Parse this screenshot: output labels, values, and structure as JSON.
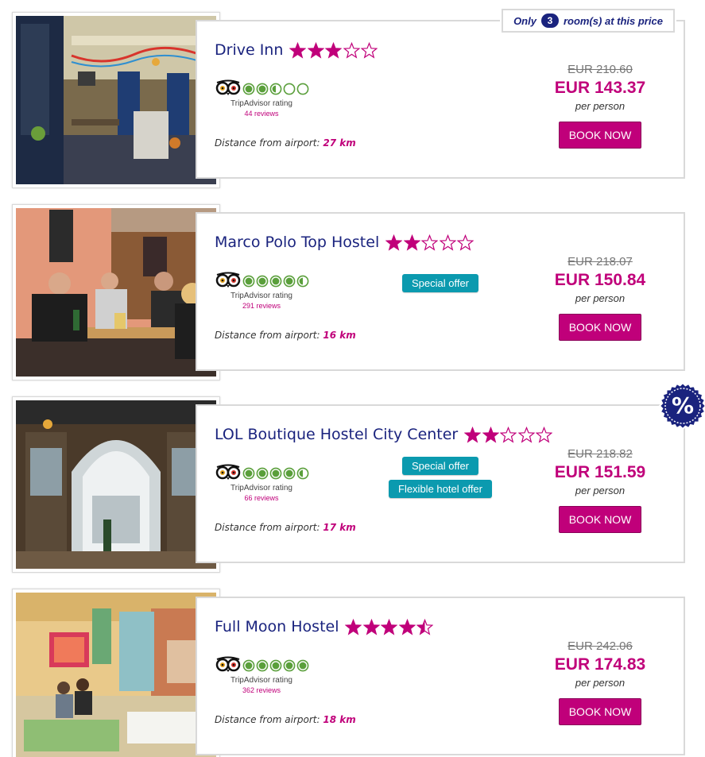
{
  "availability_tag": {
    "prefix": "Only",
    "count": "3",
    "suffix": "room(s) at this price"
  },
  "discount_seal": {
    "symbol": "%",
    "color": "#1a237e"
  },
  "colors": {
    "accent": "#c0007a",
    "navy": "#1a237e",
    "teal": "#0b9aaf",
    "tripadvisor_green": "#5a9f3b"
  },
  "labels": {
    "tripadvisor": "TripAdvisor rating",
    "distance_prefix": "Distance from airport:",
    "per_person": "per person",
    "book_now": "BOOK NOW"
  },
  "hotels": [
    {
      "name": "Drive Inn",
      "stars": 3,
      "ta_rating": 2.5,
      "reviews": "44 reviews",
      "distance": "27 km",
      "old_price": "EUR 210.60",
      "price": "EUR 143.37",
      "badges": [],
      "photo": "hostel-bar-interior"
    },
    {
      "name": "Marco Polo Top Hostel",
      "stars": 2,
      "ta_rating": 4.5,
      "reviews": "291 reviews",
      "distance": "16 km",
      "old_price": "EUR 218.07",
      "price": "EUR 150.84",
      "badges": [
        "Special offer"
      ],
      "photo": "people-playing-cards"
    },
    {
      "name": "LOL Boutique Hostel City Center",
      "stars": 2,
      "ta_rating": 4.5,
      "reviews": "66 reviews",
      "distance": "17 km",
      "old_price": "EUR 218.82",
      "price": "EUR 151.59",
      "badges": [
        "Special offer",
        "Flexible hotel offer"
      ],
      "photo": "arched-courtyard-doorway"
    },
    {
      "name": "Full Moon Hostel",
      "stars": 4.5,
      "ta_rating": 5,
      "reviews": "362 reviews",
      "distance": "18 km",
      "old_price": "EUR 242.06",
      "price": "EUR 174.83",
      "badges": [],
      "photo": "cafe-with-posters"
    }
  ]
}
